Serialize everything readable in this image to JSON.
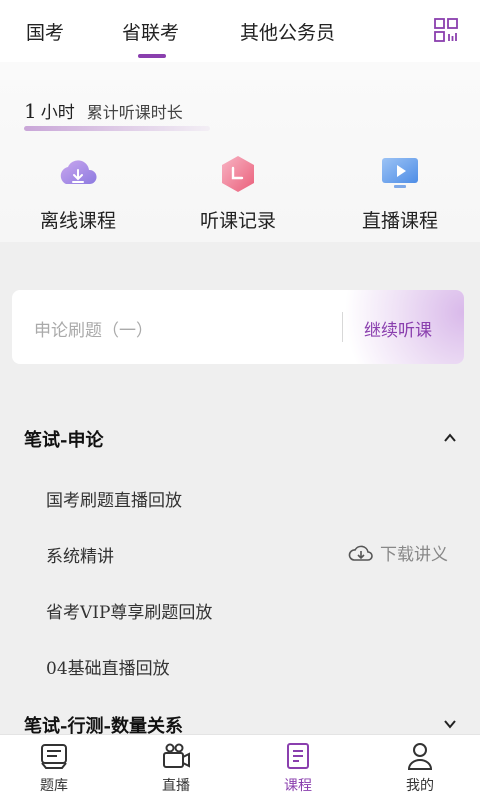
{
  "top_tabs": [
    {
      "label": "国考"
    },
    {
      "label": "省联考"
    },
    {
      "label": "其他公务员"
    }
  ],
  "active_tab": "省联考",
  "stats": {
    "hours_value": "1",
    "hours_unit": "小时",
    "hours_label": "累计听课时长"
  },
  "quick_links": [
    {
      "label": "离线课程",
      "icon": "cloud-download-icon"
    },
    {
      "label": "听课记录",
      "icon": "clock-hexagon-icon"
    },
    {
      "label": "直播课程",
      "icon": "monitor-play-icon"
    }
  ],
  "continue": {
    "title": "申论刷题（一）",
    "button": "继续听课"
  },
  "sections": [
    {
      "title": "笔试-申论",
      "expanded": true,
      "lessons": [
        "国考刷题直播回放",
        "系统精讲",
        "省考VIP尊享刷题回放",
        "04基础直播回放"
      ]
    },
    {
      "title": "笔试-行测-数量关系",
      "expanded": false
    }
  ],
  "download_label": "下载讲义",
  "bottom_nav": [
    {
      "label": "题库",
      "icon": "question-bank-icon"
    },
    {
      "label": "直播",
      "icon": "video-camera-icon"
    },
    {
      "label": "课程",
      "icon": "course-book-icon"
    },
    {
      "label": "我的",
      "icon": "user-icon"
    }
  ],
  "active_nav": "课程",
  "colors": {
    "accent": "#8a3fae",
    "background": "#efefef"
  }
}
